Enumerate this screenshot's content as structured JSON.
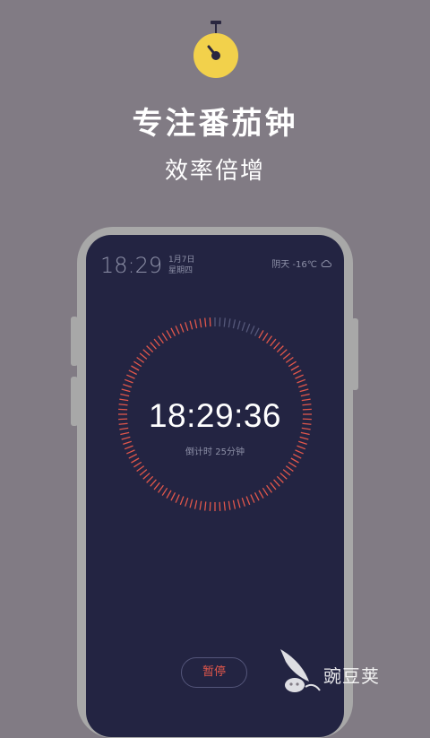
{
  "header": {
    "title": "专注番茄钟",
    "subtitle": "效率倍增",
    "icon": "stopwatch-icon",
    "icon_color": "#f2d14b"
  },
  "phone_screen": {
    "status": {
      "time": "18:29",
      "date": "1月7日",
      "weekday": "星期四",
      "weather": "阴天 -16℃",
      "weather_icon": "cloud-icon"
    },
    "timer": {
      "clock": "18:29:36",
      "countdown_label": "倒计时 25分钟",
      "progress": 0.92,
      "accent_color": "#e2574b"
    },
    "pause_label": "暂停"
  },
  "watermark": {
    "text": "豌豆荚"
  }
}
